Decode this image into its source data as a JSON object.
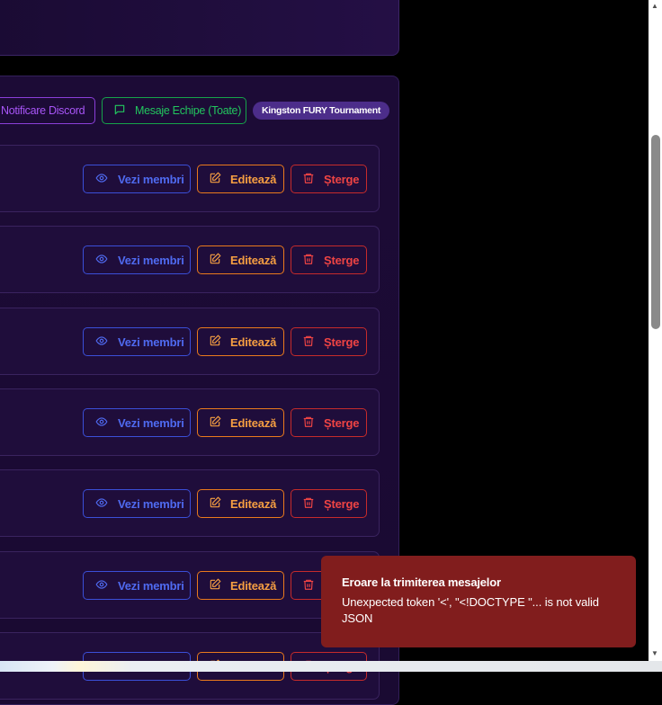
{
  "toolbar": {
    "notify_label": "Notificare Discord",
    "messages_label": "Mesaje Echipe (Toate)",
    "tournament_badge": "Kingston FURY Tournament"
  },
  "team_actions": {
    "view_label": "Vezi membri",
    "edit_label": "Editează",
    "delete_label": "Șterge"
  },
  "toast": {
    "title": "Eroare la trimiterea mesajelor",
    "message": "Unexpected token '<', \"<!DOCTYPE \"... is not valid JSON"
  },
  "colors": {
    "background": "#000000",
    "panel": "#1c0b36",
    "view_accent": "#4f6af0",
    "edit_accent": "#f59e42",
    "delete_accent": "#ef4444",
    "discord_accent": "#a855f7",
    "messages_accent": "#22c55e",
    "toast_bg": "#811d1d"
  },
  "icons": {
    "view": "eye-icon",
    "edit": "pencil-square-icon",
    "delete": "trash-icon",
    "messages": "chat-bubble-icon"
  }
}
